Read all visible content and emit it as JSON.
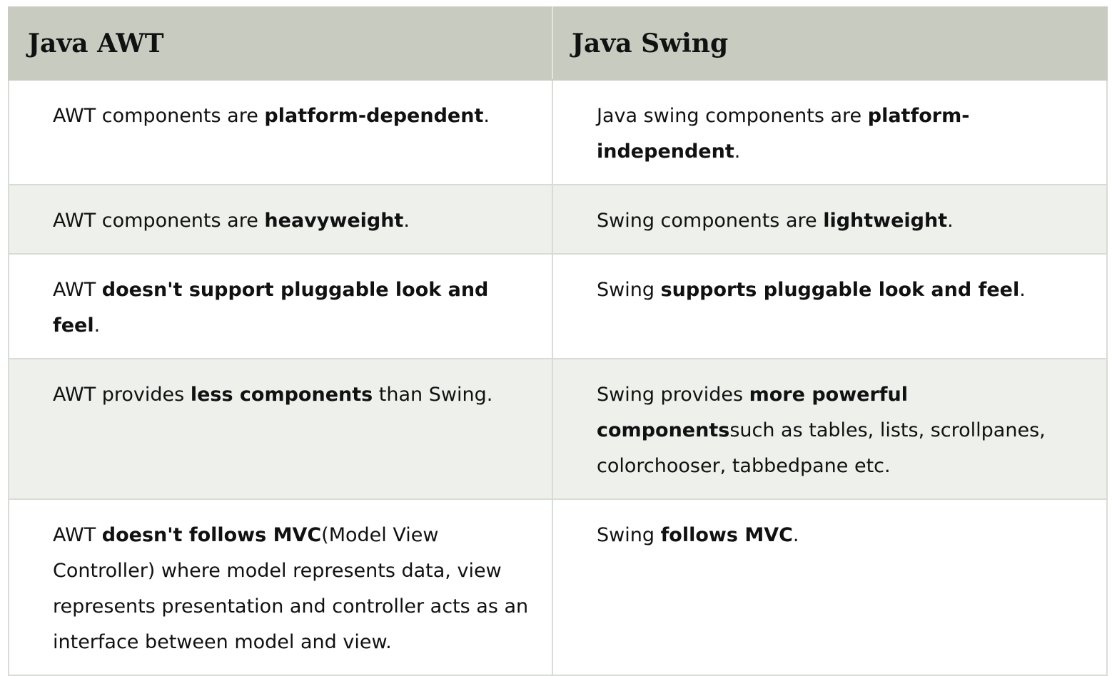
{
  "table": {
    "headers": [
      "Java AWT",
      "Java Swing"
    ],
    "rows": [
      {
        "awt": [
          "AWT components are ",
          "platform-dependent",
          "."
        ],
        "swing": [
          "Java swing components are ",
          "platform-independent",
          "."
        ]
      },
      {
        "awt": [
          "AWT components are ",
          "heavyweight",
          "."
        ],
        "swing": [
          "Swing components are ",
          "lightweight",
          "."
        ]
      },
      {
        "awt": [
          "AWT ",
          "doesn't support pluggable look and feel",
          "."
        ],
        "swing": [
          "Swing ",
          "supports pluggable look and feel",
          "."
        ]
      },
      {
        "awt": [
          "AWT provides ",
          "less components",
          " than Swing."
        ],
        "swing": [
          "Swing provides ",
          "more powerful components",
          "such as tables, lists, scrollpanes, colorchooser, tabbedpane etc."
        ]
      },
      {
        "awt": [
          "AWT ",
          "doesn't follows MVC",
          "(Model View Controller) where model represents data, view represents presentation and controller acts as an interface between model and view."
        ],
        "swing": [
          "Swing ",
          "follows MVC",
          "."
        ]
      }
    ]
  }
}
